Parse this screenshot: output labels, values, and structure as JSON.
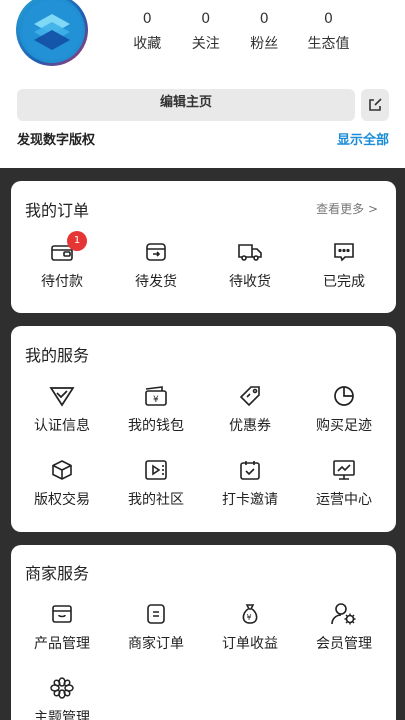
{
  "profile": {
    "stats": [
      {
        "value": "0",
        "label": "收藏"
      },
      {
        "value": "0",
        "label": "关注"
      },
      {
        "value": "0",
        "label": "粉丝"
      },
      {
        "value": "0",
        "label": "生态值"
      }
    ],
    "edit_label": "编辑主页",
    "discover_label": "发现数字版权",
    "show_all_label": "显示全部"
  },
  "orders": {
    "title": "我的订单",
    "more_label": "查看更多 >",
    "items": [
      {
        "label": "待付款",
        "icon": "wallet-icon",
        "badge": "1"
      },
      {
        "label": "待发货",
        "icon": "ship-box-icon"
      },
      {
        "label": "待收货",
        "icon": "truck-icon"
      },
      {
        "label": "已完成",
        "icon": "chat-dots-icon"
      }
    ]
  },
  "services": {
    "title": "我的服务",
    "items": [
      {
        "label": "认证信息",
        "icon": "verify-icon"
      },
      {
        "label": "我的钱包",
        "icon": "purse-icon"
      },
      {
        "label": "优惠券",
        "icon": "coupon-tag-icon"
      },
      {
        "label": "购买足迹",
        "icon": "pie-icon"
      },
      {
        "label": "版权交易",
        "icon": "cube-icon"
      },
      {
        "label": "我的社区",
        "icon": "video-icon"
      },
      {
        "label": "打卡邀请",
        "icon": "calendar-check-icon"
      },
      {
        "label": "运营中心",
        "icon": "monitor-icon"
      }
    ]
  },
  "merchant": {
    "title": "商家服务",
    "items": [
      {
        "label": "产品管理",
        "icon": "archive-box-icon"
      },
      {
        "label": "商家订单",
        "icon": "list-doc-icon"
      },
      {
        "label": "订单收益",
        "icon": "money-bag-icon"
      },
      {
        "label": "会员管理",
        "icon": "user-gear-icon"
      },
      {
        "label": "主题管理",
        "icon": "flower-icon"
      }
    ]
  },
  "colors": {
    "accent": "#1a8cd8",
    "badge": "#e63535",
    "background": "#2f2f2f"
  }
}
